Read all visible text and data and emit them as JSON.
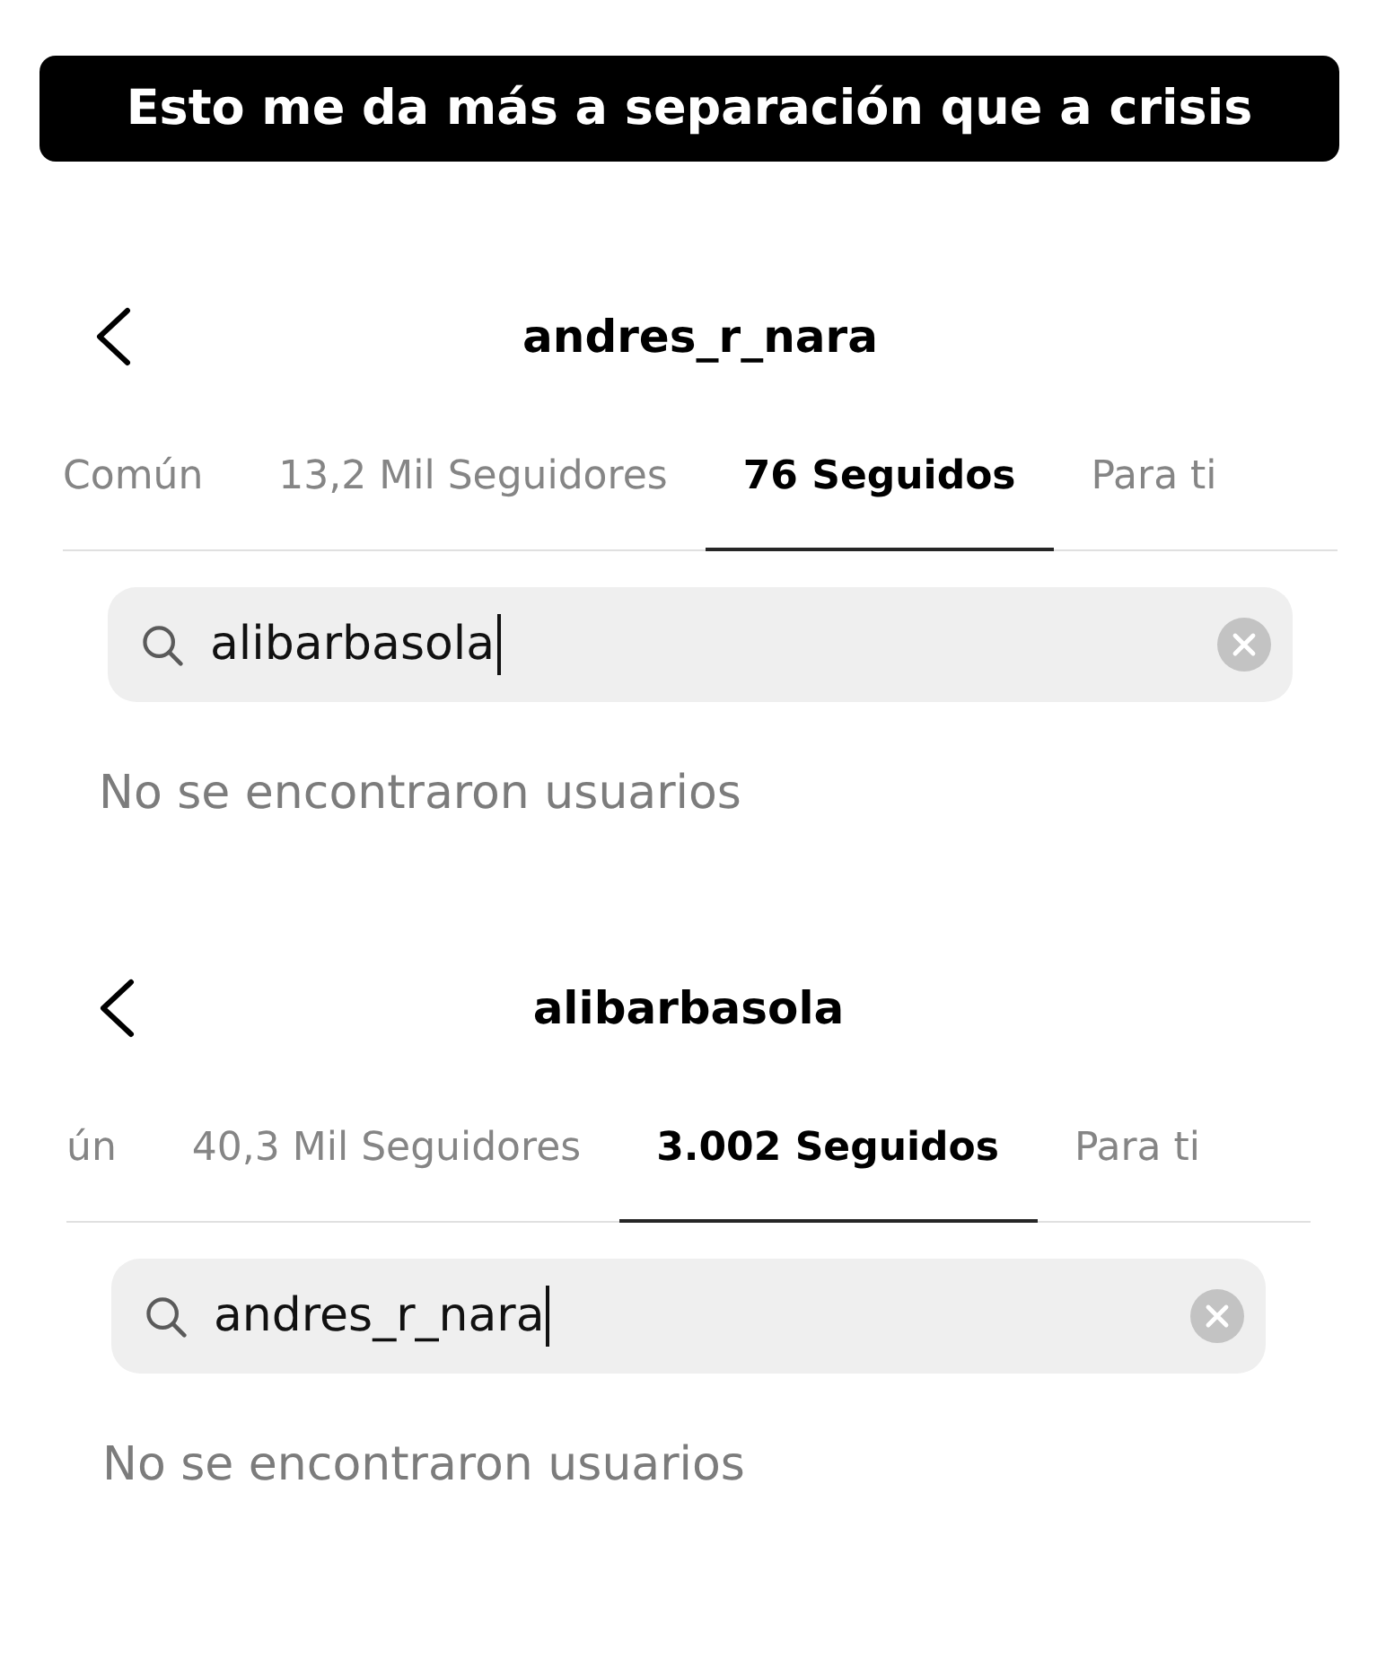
{
  "caption": {
    "text": "Esto me da más a separación que a crisis"
  },
  "panels": [
    {
      "title": "andres_r_nara",
      "tabs": [
        {
          "label": "Común",
          "selected": false
        },
        {
          "label": "13,2 Mil Seguidores",
          "selected": false
        },
        {
          "label": "76 Seguidos",
          "selected": true
        },
        {
          "label": "Para ti",
          "selected": false
        }
      ],
      "search": {
        "value": "alibarbasola",
        "focused": true
      },
      "empty_message": "No se encontraron usuarios"
    },
    {
      "title": "alibarbasola",
      "tabs": [
        {
          "label": "ún",
          "selected": false
        },
        {
          "label": "40,3 Mil Seguidores",
          "selected": false
        },
        {
          "label": "3.002 Seguidos",
          "selected": true
        },
        {
          "label": "Para ti",
          "selected": false
        }
      ],
      "search": {
        "value": "andres_r_nara",
        "focused": true
      },
      "empty_message": "No se encontraron usuarios"
    }
  ]
}
